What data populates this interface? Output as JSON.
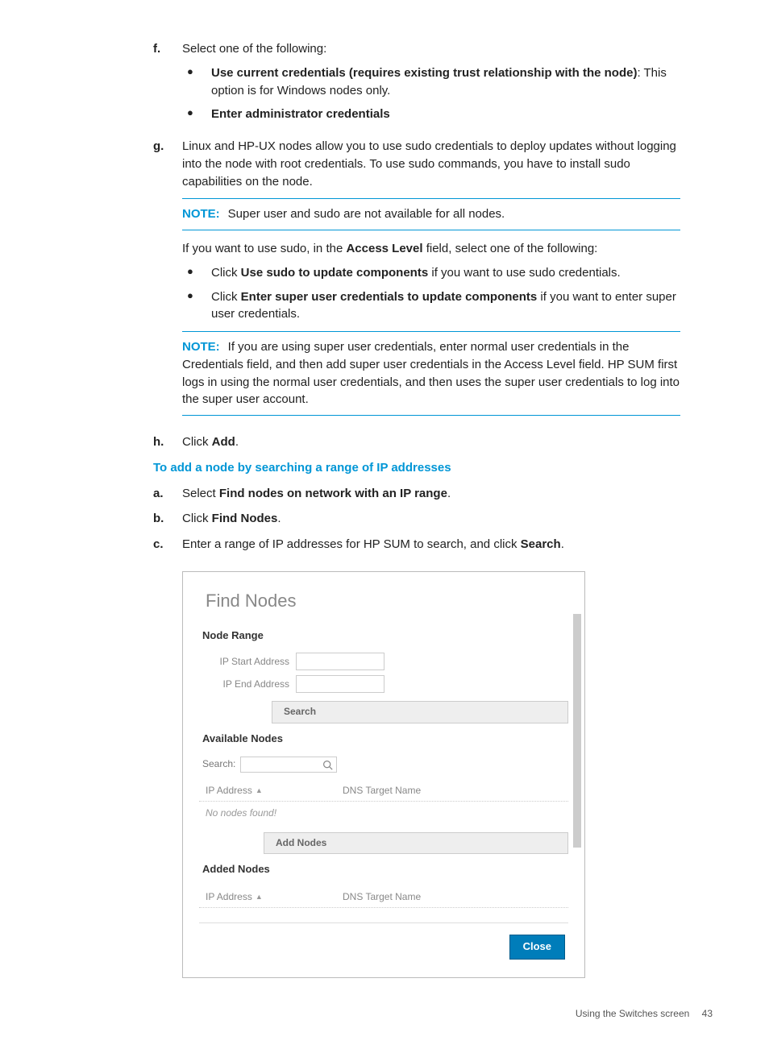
{
  "step_f": {
    "marker": "f.",
    "text": "Select one of the following:",
    "bullets": [
      {
        "bold": "Use current credentials (requires existing trust relationship with the node)",
        "tail": ": This option is for Windows nodes only."
      },
      {
        "bold": "Enter administrator credentials",
        "tail": ""
      }
    ]
  },
  "step_g": {
    "marker": "g.",
    "text": "Linux and HP-UX nodes allow you to use sudo credentials to deploy updates without logging into the node with root credentials. To use sudo commands, you have to install sudo capabilities on the node.",
    "note1_label": "NOTE:",
    "note1_text": "Super user and sudo are not available for all nodes.",
    "access_pre": "If you want to use sudo, in the ",
    "access_bold": "Access Level",
    "access_post": " field, select one of the following:",
    "bullets": [
      {
        "pre": "Click ",
        "bold": "Use sudo to update components",
        "post": " if you want to use sudo credentials."
      },
      {
        "pre": "Click ",
        "bold": "Enter super user credentials to update components",
        "post": " if you want to enter super user credentials."
      }
    ],
    "note2_label": "NOTE:",
    "note2_text": "If you are using super user credentials, enter normal user credentials in the Credentials field, and then add super user credentials in the Access Level field. HP SUM first logs in using the normal user credentials, and then uses the super user credentials to log into the super user account."
  },
  "step_h": {
    "marker": "h.",
    "pre": "Click ",
    "bold": "Add",
    "post": "."
  },
  "subhead": "To add a node by searching a range of IP addresses",
  "step_a": {
    "marker": "a.",
    "pre": "Select ",
    "bold": "Find nodes on network with an IP range",
    "post": "."
  },
  "step_b": {
    "marker": "b.",
    "pre": "Click ",
    "bold": "Find Nodes",
    "post": "."
  },
  "step_c": {
    "marker": "c.",
    "pre": "Enter a range of IP addresses for HP SUM to search, and click ",
    "bold": "Search",
    "post": "."
  },
  "dialog": {
    "title": "Find Nodes",
    "range_title": "Node Range",
    "ip_start_label": "IP Start Address",
    "ip_end_label": "IP End Address",
    "search_btn": "Search",
    "available_title": "Available Nodes",
    "search_label": "Search:",
    "col_ip": "IP Address",
    "col_dns": "DNS Target Name",
    "no_nodes": "No nodes found!",
    "add_nodes_btn": "Add Nodes",
    "added_title": "Added Nodes",
    "close_btn": "Close"
  },
  "footer": {
    "text": "Using the Switches screen",
    "page": "43"
  }
}
